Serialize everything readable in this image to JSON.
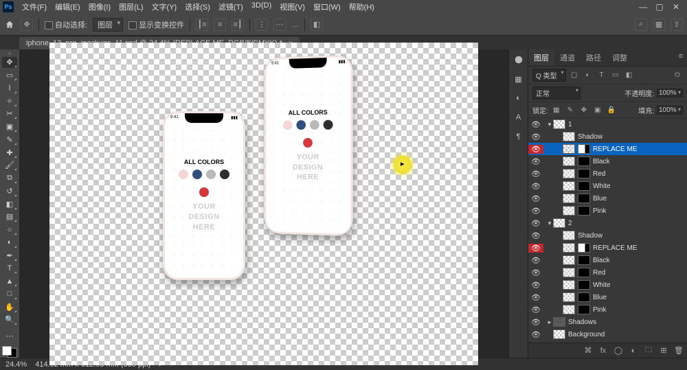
{
  "menubar": {
    "items": [
      "文件(F)",
      "编辑(E)",
      "图像(I)",
      "图层(L)",
      "文字(Y)",
      "选择(S)",
      "滤镜(T)",
      "3D(D)",
      "视图(V)",
      "窗口(W)",
      "帮助(H)"
    ]
  },
  "optionsbar": {
    "auto_select_label": "自动选择:",
    "auto_select_value": "图层",
    "show_transform_label": "显示变换控件"
  },
  "doc_tab": {
    "title": "iphone_13_pro_mockups_11.psd @ 24.4% (REPLACE ME, RGB/8/CMYK) *"
  },
  "canvas": {
    "all_colors": "ALL COLORS",
    "your_design_here_l1": "YOUR",
    "your_design_here_l2": "DESIGN",
    "your_design_here_l3": "HERE",
    "time": "9:41"
  },
  "statusbar": {
    "zoom": "24.4%",
    "info": "414.02 mm x 312.93 mm (300 ppi)"
  },
  "panel": {
    "tabs": [
      "图层",
      "通道",
      "路径",
      "调整"
    ],
    "kind_label": "Q 类型",
    "blend_mode": "正常",
    "opacity_label": "不透明度:",
    "opacity_value": "100%",
    "lock_label": "锁定:",
    "fill_label": "填充:",
    "fill_value": "100%"
  },
  "layers": [
    {
      "depth": 0,
      "vis": true,
      "twist": "▾",
      "folder": false,
      "thumb": "tbg",
      "mask": null,
      "name": "1",
      "group": true
    },
    {
      "depth": 1,
      "vis": true,
      "twist": "",
      "folder": false,
      "thumb": "tbg",
      "mask": null,
      "name": "Shadow"
    },
    {
      "depth": 1,
      "vis": true,
      "visred": true,
      "twist": "",
      "folder": false,
      "thumb": "so",
      "mask": "mask",
      "name": "REPLACE ME",
      "selected": true
    },
    {
      "depth": 1,
      "vis": true,
      "twist": "",
      "folder": false,
      "thumb": "tbg",
      "mask": "mask2",
      "name": "Black"
    },
    {
      "depth": 1,
      "vis": true,
      "twist": "",
      "folder": false,
      "thumb": "tbg",
      "mask": "mask2",
      "name": "Red"
    },
    {
      "depth": 1,
      "vis": true,
      "twist": "",
      "folder": false,
      "thumb": "tbg",
      "mask": "mask2",
      "name": "White"
    },
    {
      "depth": 1,
      "vis": true,
      "twist": "",
      "folder": false,
      "thumb": "tbg",
      "mask": "mask2",
      "name": "Blue"
    },
    {
      "depth": 1,
      "vis": true,
      "twist": "",
      "folder": false,
      "thumb": "tbg",
      "mask": "mask2",
      "name": "Pink"
    },
    {
      "depth": 0,
      "vis": true,
      "twist": "▾",
      "folder": false,
      "thumb": "tbg",
      "mask": null,
      "name": "2",
      "group": true
    },
    {
      "depth": 1,
      "vis": true,
      "twist": "",
      "folder": false,
      "thumb": "tbg",
      "mask": null,
      "name": "Shadow"
    },
    {
      "depth": 1,
      "vis": true,
      "visred": true,
      "twist": "",
      "folder": false,
      "thumb": "so",
      "mask": "mask",
      "name": "REPLACE ME"
    },
    {
      "depth": 1,
      "vis": true,
      "twist": "",
      "folder": false,
      "thumb": "tbg",
      "mask": "mask2",
      "name": "Black"
    },
    {
      "depth": 1,
      "vis": true,
      "twist": "",
      "folder": false,
      "thumb": "tbg",
      "mask": "mask2",
      "name": "Red"
    },
    {
      "depth": 1,
      "vis": true,
      "twist": "",
      "folder": false,
      "thumb": "tbg",
      "mask": "mask2",
      "name": "White"
    },
    {
      "depth": 1,
      "vis": true,
      "twist": "",
      "folder": false,
      "thumb": "tbg",
      "mask": "mask2",
      "name": "Blue"
    },
    {
      "depth": 1,
      "vis": true,
      "twist": "",
      "folder": false,
      "thumb": "tbg",
      "mask": "mask2",
      "name": "Pink"
    },
    {
      "depth": 0,
      "vis": true,
      "twist": "▸",
      "folder": true,
      "thumb": "folder",
      "mask": null,
      "name": "Shadows"
    },
    {
      "depth": 0,
      "vis": true,
      "twist": "",
      "folder": false,
      "thumb": "tbg",
      "mask": null,
      "name": "Background"
    }
  ]
}
